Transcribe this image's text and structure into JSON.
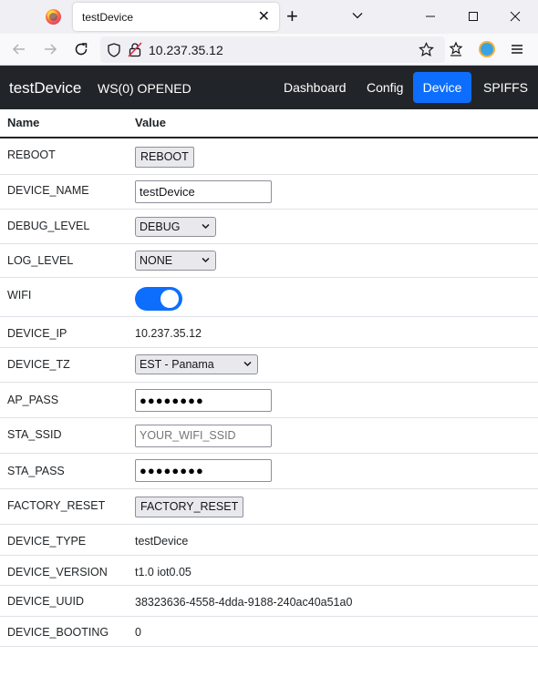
{
  "browser": {
    "tab_title": "testDevice",
    "close_glyph": "✕",
    "new_tab_glyph": "+",
    "url": "10.237.35.12",
    "icons": [
      "firefox-logo",
      "back-icon",
      "forward-icon",
      "reload-icon",
      "shield-icon",
      "insecure-lock-icon",
      "bookmark-star-icon",
      "bookmarks-icon",
      "extension-icon",
      "menu-icon"
    ]
  },
  "app": {
    "brand": "testDevice",
    "ws_status": "WS(0) OPENED",
    "nav": [
      {
        "label": "Dashboard",
        "active": false
      },
      {
        "label": "Config",
        "active": false
      },
      {
        "label": "Device",
        "active": true
      },
      {
        "label": "SPIFFS",
        "active": false
      }
    ],
    "accent_color": "#0d6efd",
    "header_color": "#212529"
  },
  "table": {
    "headers": {
      "name": "Name",
      "value": "Value"
    },
    "rows": {
      "reboot": {
        "name": "REBOOT",
        "button": "REBOOT"
      },
      "device_name": {
        "name": "DEVICE_NAME",
        "value": "testDevice"
      },
      "debug_level": {
        "name": "DEBUG_LEVEL",
        "selected": "DEBUG"
      },
      "log_level": {
        "name": "LOG_LEVEL",
        "selected": "NONE"
      },
      "wifi": {
        "name": "WIFI",
        "on": true
      },
      "device_ip": {
        "name": "DEVICE_IP",
        "value": "10.237.35.12"
      },
      "device_tz": {
        "name": "DEVICE_TZ",
        "selected": "EST - Panama"
      },
      "ap_pass": {
        "name": "AP_PASS",
        "masked": "●●●●●●●●"
      },
      "sta_ssid": {
        "name": "STA_SSID",
        "placeholder": "YOUR_WIFI_SSID"
      },
      "sta_pass": {
        "name": "STA_PASS",
        "masked": "●●●●●●●●"
      },
      "factory_reset": {
        "name": "FACTORY_RESET",
        "button": "FACTORY_RESET"
      },
      "device_type": {
        "name": "DEVICE_TYPE",
        "value": "testDevice"
      },
      "device_version": {
        "name": "DEVICE_VERSION",
        "value": "t1.0 iot0.05"
      },
      "device_uuid": {
        "name": "DEVICE_UUID",
        "value": "38323636-4558-4dda-9188-240ac40a51a0"
      },
      "device_booting": {
        "name": "DEVICE_BOOTING",
        "value": "0"
      }
    }
  }
}
